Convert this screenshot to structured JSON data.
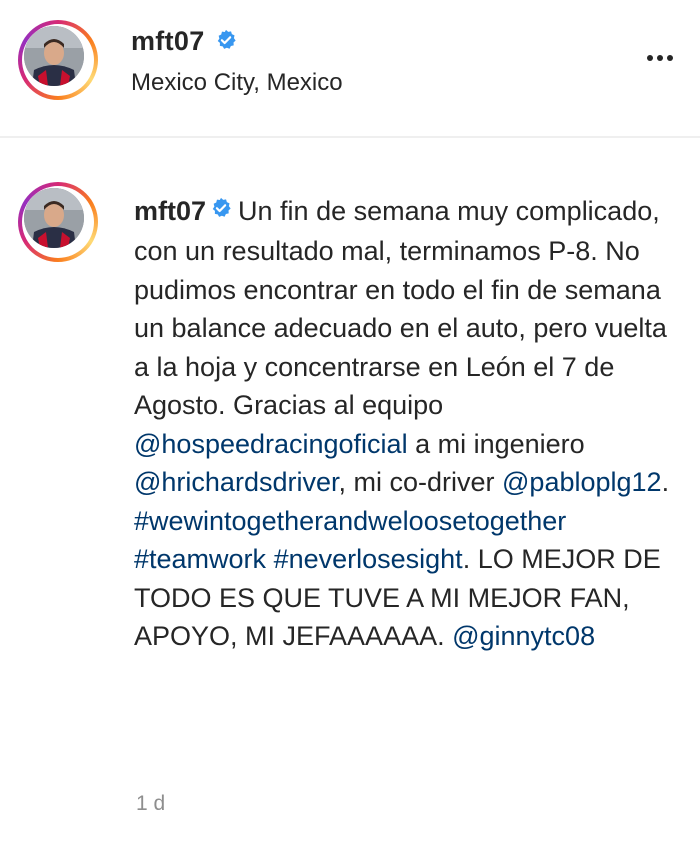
{
  "header": {
    "username": "mft07",
    "location": "Mexico City, Mexico"
  },
  "comment": {
    "username": "mft07",
    "segments": [
      {
        "type": "text",
        "text": "Un fin de semana muy complicado, con un resultado mal, terminamos P-8. No pudimos encontrar en todo el fin de semana un balance adecuado en el auto, pero vuelta a la hoja y concentrarse en León el 7 de Agosto. Gracias al equipo "
      },
      {
        "type": "link",
        "text": "@hospeedracingoficial"
      },
      {
        "type": "text",
        "text": " a mi ingeniero "
      },
      {
        "type": "link",
        "text": "@hrichardsdriver"
      },
      {
        "type": "text",
        "text": ", mi co-driver "
      },
      {
        "type": "link",
        "text": "@pabloplg12"
      },
      {
        "type": "text",
        "text": ". "
      },
      {
        "type": "link",
        "text": "#wewintogetherandweloosetogether"
      },
      {
        "type": "text",
        "text": " "
      },
      {
        "type": "link",
        "text": "#teamwork"
      },
      {
        "type": "text",
        "text": " "
      },
      {
        "type": "link",
        "text": "#neverlosesight"
      },
      {
        "type": "text",
        "text": ". LO MEJOR DE TODO ES QUE TUVE A MI MEJOR FAN, APOYO, MI JEFAAAAAA. "
      },
      {
        "type": "link",
        "text": "@ginnytc08"
      }
    ],
    "timestamp": "1 d"
  },
  "icons": {
    "verified": "verified-badge-icon",
    "more": "more-options-icon"
  },
  "colors": {
    "link": "#00376b",
    "verified": "#3897f0",
    "timestamp": "#8e8e8e"
  }
}
